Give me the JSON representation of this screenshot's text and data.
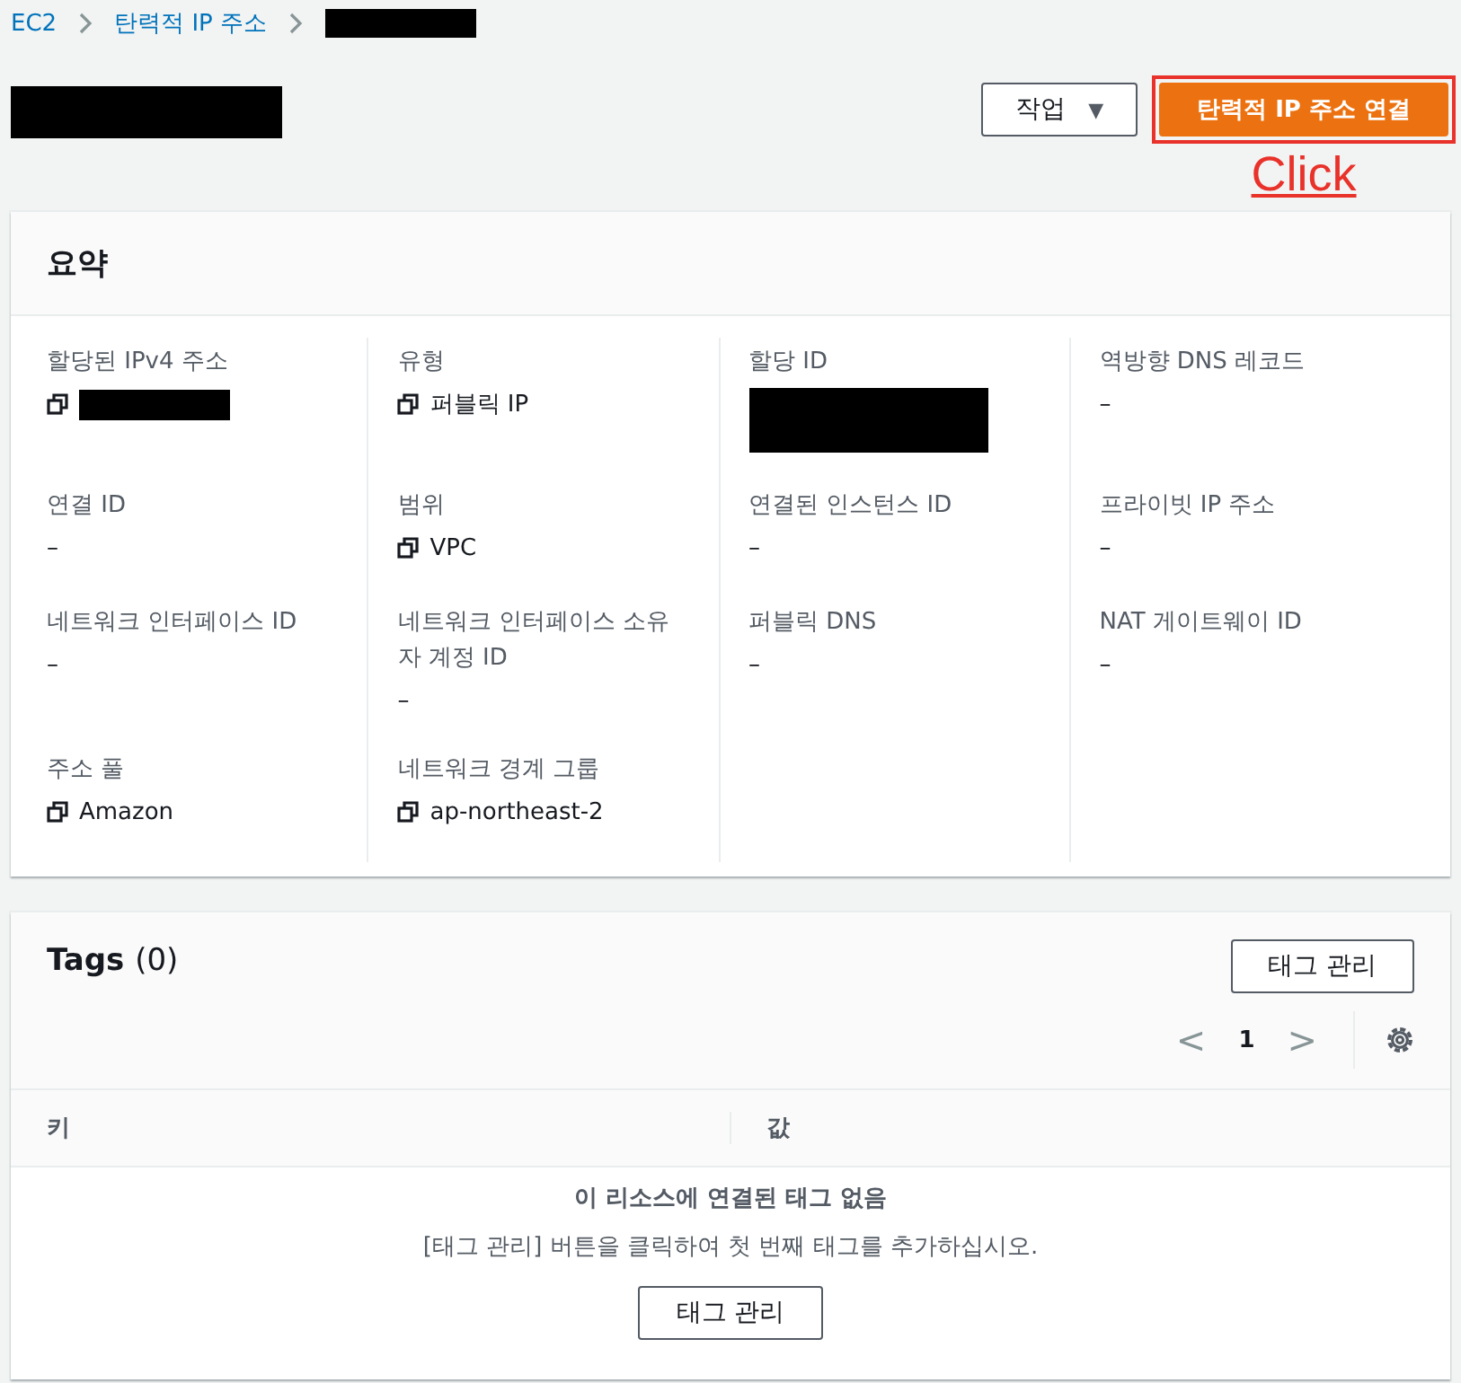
{
  "breadcrumbs": [
    {
      "label": "EC2",
      "kind": "link"
    },
    {
      "label": "탄력적 IP 주소",
      "kind": "link"
    },
    {
      "kind": "redacted"
    }
  ],
  "header": {
    "title": {
      "kind": "redacted"
    },
    "actions_button": {
      "label": "작업",
      "caret": "▼"
    },
    "primary_button": {
      "label": "탄력적 IP 주소 연결",
      "highlighted": true
    },
    "annotation": "Click"
  },
  "summary": {
    "title": "요약",
    "fields": [
      {
        "label": "할당된 IPv4 주소",
        "copyable": true,
        "value": {
          "kind": "redacted"
        }
      },
      {
        "label": "유형",
        "copyable": true,
        "value": {
          "kind": "text",
          "text": "퍼블릭 IP"
        }
      },
      {
        "label": "할당 ID",
        "copyable": false,
        "value": {
          "kind": "redacted_tall"
        }
      },
      {
        "label": "역방향 DNS 레코드",
        "copyable": false,
        "value": {
          "kind": "text",
          "text": "–"
        }
      },
      {
        "label": "연결 ID",
        "copyable": false,
        "value": {
          "kind": "text",
          "text": "–"
        }
      },
      {
        "label": "범위",
        "copyable": true,
        "value": {
          "kind": "text",
          "text": "VPC"
        }
      },
      {
        "label": "연결된 인스턴스 ID",
        "copyable": false,
        "value": {
          "kind": "text",
          "text": "–"
        }
      },
      {
        "label": "프라이빗 IP 주소",
        "copyable": false,
        "value": {
          "kind": "text",
          "text": "–"
        }
      },
      {
        "label": "네트워크 인터페이스 ID",
        "copyable": false,
        "value": {
          "kind": "text",
          "text": "–"
        }
      },
      {
        "label": "네트워크 인터페이스 소유자 계정 ID",
        "copyable": false,
        "value": {
          "kind": "text",
          "text": "–"
        }
      },
      {
        "label": "퍼블릭 DNS",
        "copyable": false,
        "value": {
          "kind": "text",
          "text": "–"
        }
      },
      {
        "label": "NAT 게이트웨이 ID",
        "copyable": false,
        "value": {
          "kind": "text",
          "text": "–"
        }
      },
      {
        "label": "주소 풀",
        "copyable": true,
        "value": {
          "kind": "text",
          "text": "Amazon"
        }
      },
      {
        "label": "네트워크 경계 그룹",
        "copyable": true,
        "value": {
          "kind": "text",
          "text": "ap-northeast-2"
        }
      }
    ]
  },
  "tags": {
    "title": "Tags",
    "count": "(0)",
    "manage_button": "태그 관리",
    "pagination": {
      "prev": "<",
      "page": "1",
      "next": ">"
    },
    "table": {
      "columns": [
        "키",
        "값"
      ]
    },
    "empty": {
      "title": "이 리소스에 연결된 태그 없음",
      "message": "[태그 관리] 버튼을 클릭하여 첫 번째 태그를 추가하십시오.",
      "button": "태그 관리"
    }
  }
}
